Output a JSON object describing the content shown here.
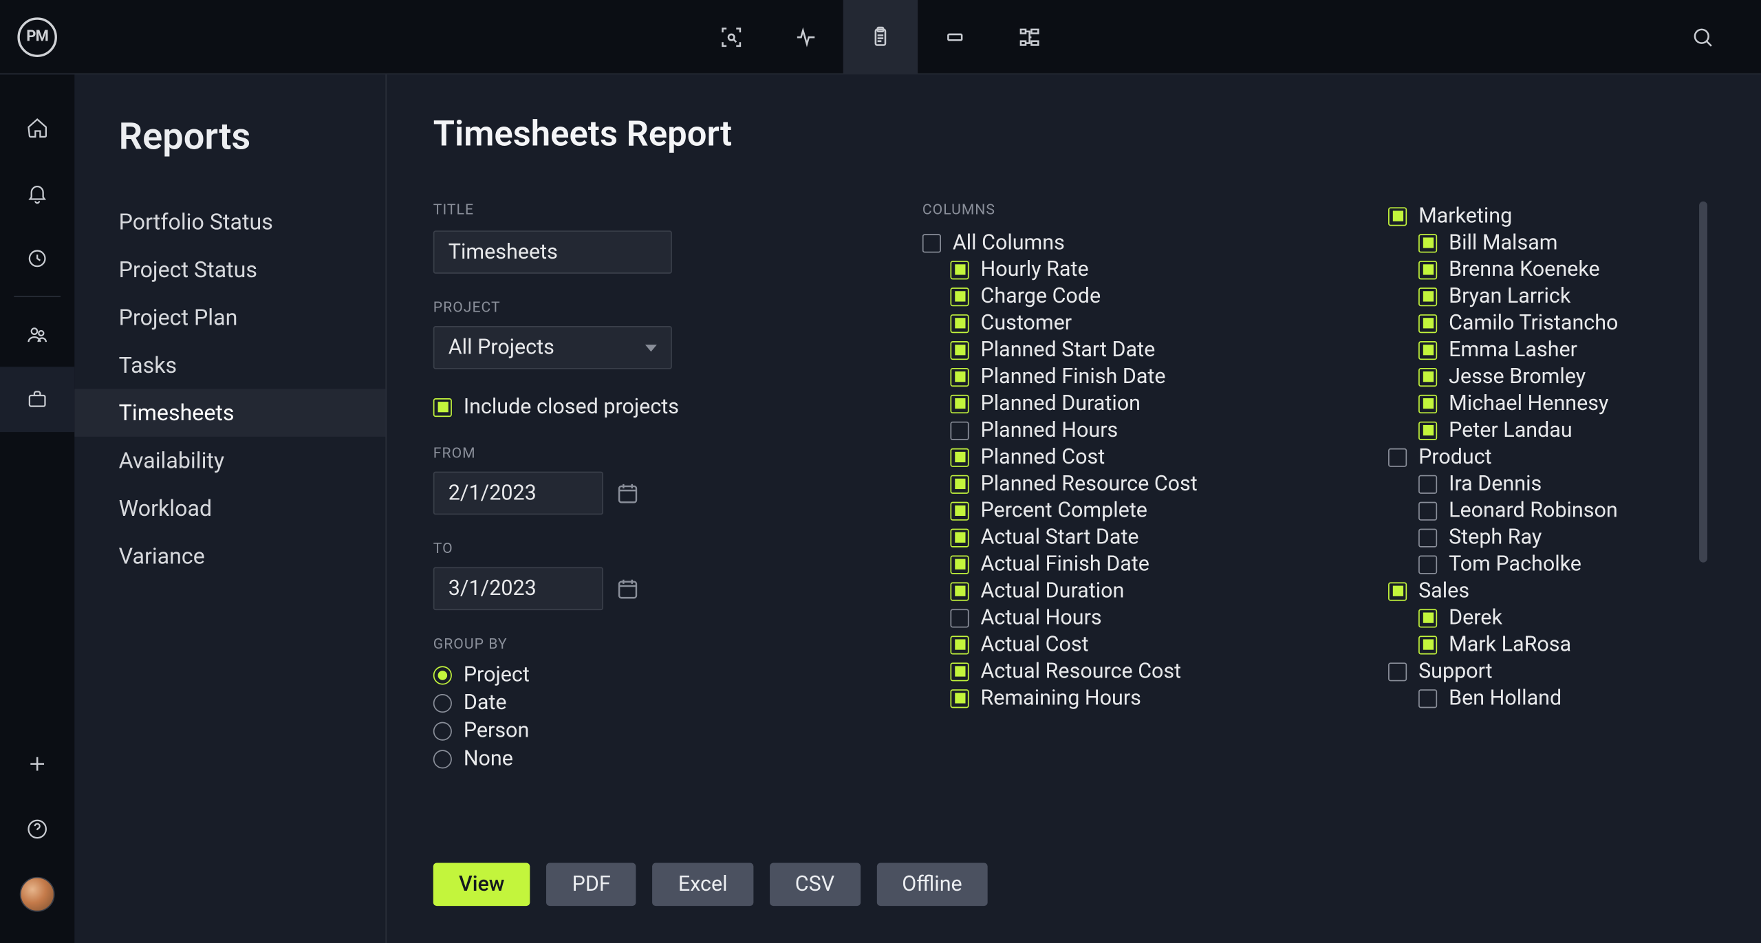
{
  "logo_text": "PM",
  "sidebar": {
    "title": "Reports",
    "items": [
      {
        "label": "Portfolio Status",
        "active": false
      },
      {
        "label": "Project Status",
        "active": false
      },
      {
        "label": "Project Plan",
        "active": false
      },
      {
        "label": "Tasks",
        "active": false
      },
      {
        "label": "Timesheets",
        "active": true
      },
      {
        "label": "Availability",
        "active": false
      },
      {
        "label": "Workload",
        "active": false
      },
      {
        "label": "Variance",
        "active": false
      }
    ]
  },
  "page_title": "Timesheets Report",
  "form": {
    "title_label": "TITLE",
    "title_value": "Timesheets",
    "project_label": "PROJECT",
    "project_value": "All Projects",
    "include_closed_label": "Include closed projects",
    "include_closed_checked": true,
    "from_label": "FROM",
    "from_value": "2/1/2023",
    "to_label": "TO",
    "to_value": "3/1/2023",
    "group_by_label": "GROUP BY",
    "group_by_options": [
      {
        "label": "Project",
        "selected": true
      },
      {
        "label": "Date",
        "selected": false
      },
      {
        "label": "Person",
        "selected": false
      },
      {
        "label": "None",
        "selected": false
      }
    ]
  },
  "columns": {
    "header": "COLUMNS",
    "all_label": "All Columns",
    "all_checked": false,
    "items": [
      {
        "label": "Hourly Rate",
        "checked": true
      },
      {
        "label": "Charge Code",
        "checked": true
      },
      {
        "label": "Customer",
        "checked": true
      },
      {
        "label": "Planned Start Date",
        "checked": true
      },
      {
        "label": "Planned Finish Date",
        "checked": true
      },
      {
        "label": "Planned Duration",
        "checked": true
      },
      {
        "label": "Planned Hours",
        "checked": false
      },
      {
        "label": "Planned Cost",
        "checked": true
      },
      {
        "label": "Planned Resource Cost",
        "checked": true
      },
      {
        "label": "Percent Complete",
        "checked": true
      },
      {
        "label": "Actual Start Date",
        "checked": true
      },
      {
        "label": "Actual Finish Date",
        "checked": true
      },
      {
        "label": "Actual Duration",
        "checked": true
      },
      {
        "label": "Actual Hours",
        "checked": false
      },
      {
        "label": "Actual Cost",
        "checked": true
      },
      {
        "label": "Actual Resource Cost",
        "checked": true
      },
      {
        "label": "Remaining Hours",
        "checked": true
      }
    ]
  },
  "persons": [
    {
      "group": "Marketing",
      "checked": true,
      "members": [
        {
          "name": "Bill Malsam",
          "checked": true
        },
        {
          "name": "Brenna Koeneke",
          "checked": true
        },
        {
          "name": "Bryan Larrick",
          "checked": true
        },
        {
          "name": "Camilo Tristancho",
          "checked": true
        },
        {
          "name": "Emma Lasher",
          "checked": true
        },
        {
          "name": "Jesse Bromley",
          "checked": true
        },
        {
          "name": "Michael Hennesy",
          "checked": true
        },
        {
          "name": "Peter Landau",
          "checked": true
        }
      ]
    },
    {
      "group": "Product",
      "checked": false,
      "members": [
        {
          "name": "Ira Dennis",
          "checked": false
        },
        {
          "name": "Leonard Robinson",
          "checked": false
        },
        {
          "name": "Steph Ray",
          "checked": false
        },
        {
          "name": "Tom Pacholke",
          "checked": false
        }
      ]
    },
    {
      "group": "Sales",
      "checked": true,
      "members": [
        {
          "name": "Derek",
          "checked": true
        },
        {
          "name": "Mark LaRosa",
          "checked": true
        }
      ]
    },
    {
      "group": "Support",
      "checked": false,
      "members": [
        {
          "name": "Ben Holland",
          "checked": false
        }
      ]
    }
  ],
  "buttons": {
    "view": "View",
    "pdf": "PDF",
    "excel": "Excel",
    "csv": "CSV",
    "offline": "Offline"
  }
}
